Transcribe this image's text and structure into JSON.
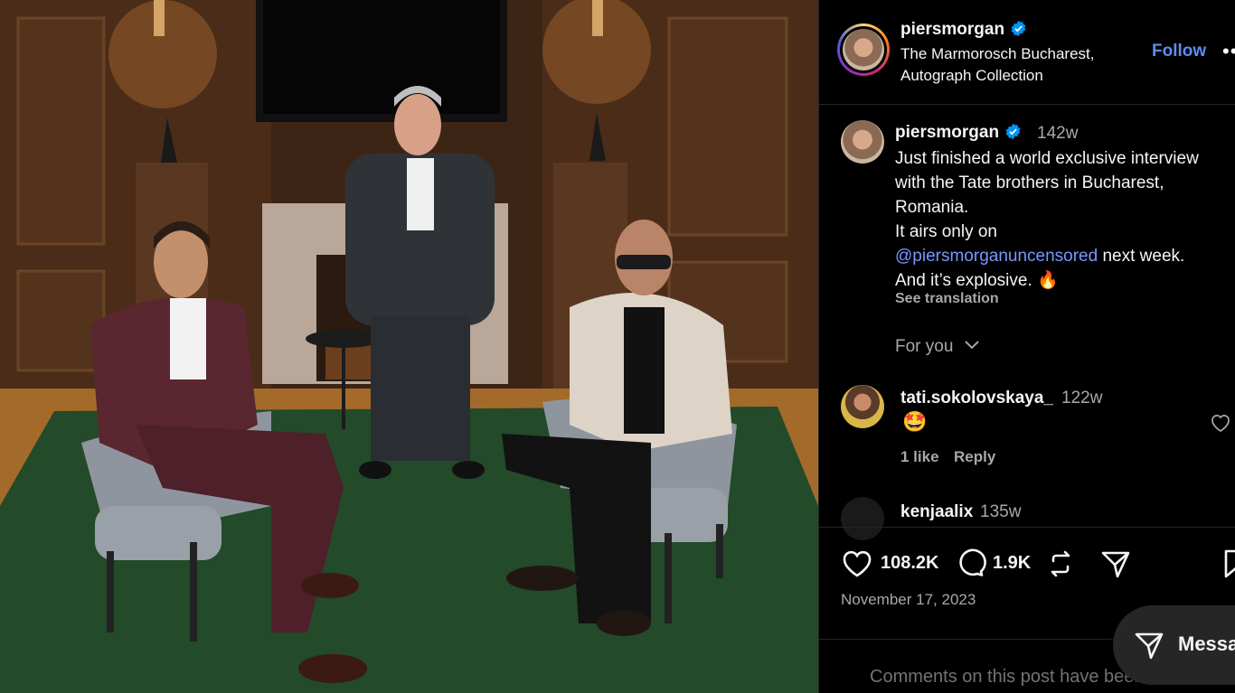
{
  "post": {
    "username": "piersmorgan",
    "location_line1": "The Marmorosch Bucharest,",
    "location_line2": "Autograph Collection",
    "follow_label": "Follow",
    "more_label": "•••"
  },
  "caption": {
    "username": "piersmorgan",
    "time": "142w",
    "line1": "Just finished a world exclusive interview",
    "line2": "with the Tate brothers in Bucharest,",
    "line3": "Romania.",
    "line4": "It airs only on",
    "mention": "@piersmorganuncensored",
    "line5_rest": " next week.",
    "line6": "And it’s explosive. 🔥",
    "see_translation": "See translation"
  },
  "for_you_label": "For you",
  "comments": [
    {
      "username": "tati.sokolovskaya_",
      "time": "122w",
      "text": "🤩",
      "likes": "1 like",
      "reply": "Reply"
    },
    {
      "username": "kenjaalix",
      "time": "135w"
    }
  ],
  "actions": {
    "likes": "108.2K",
    "comments": "1.9K",
    "date": "November 17, 2023"
  },
  "comments_limited": "Comments on this post have been limited.",
  "messages_label": "Messa",
  "colors": {
    "background": "#000000",
    "link": "#7896ff",
    "follow": "#5b8def",
    "muted": "#a8a8a8",
    "verified": "#0095f6"
  }
}
